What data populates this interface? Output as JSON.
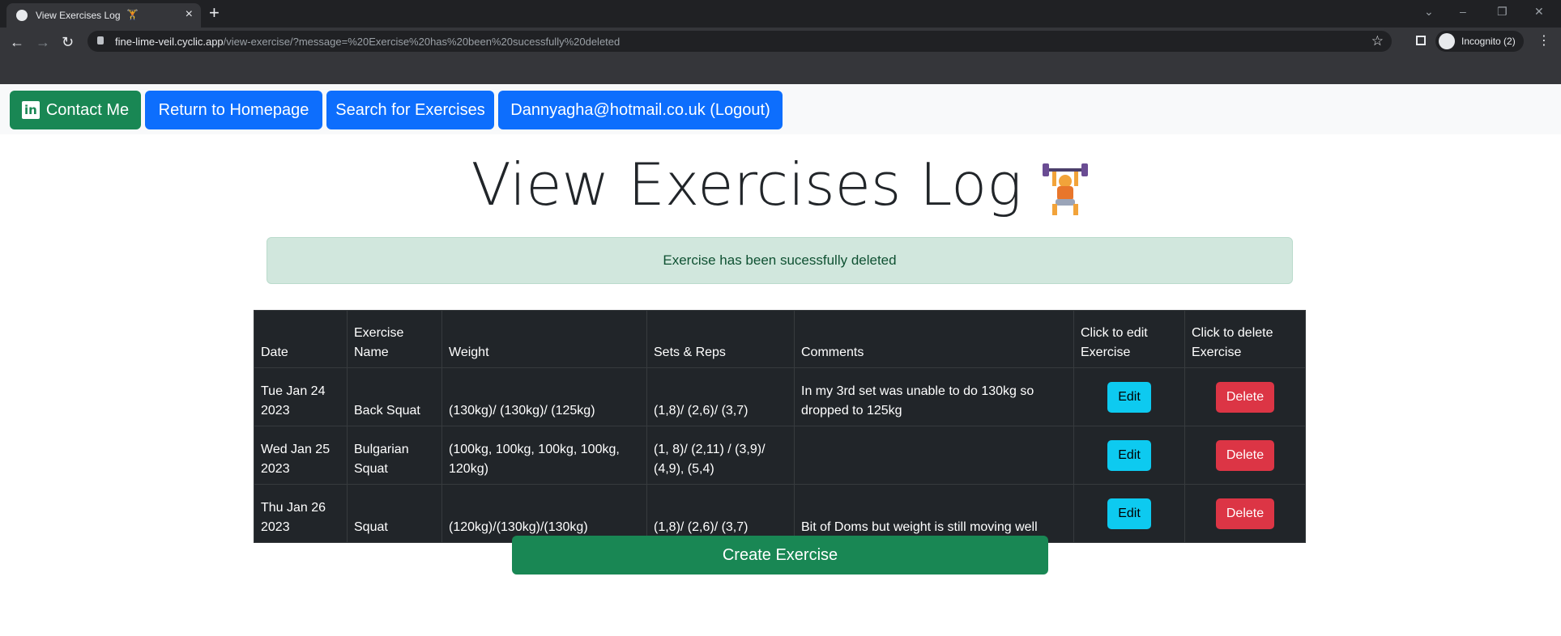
{
  "browser": {
    "tab_title": "View Exercises Log",
    "tab_emoji": "🏋",
    "tab_close": "×",
    "new_tab": "+",
    "url_host": "fine-lime-veil.cyclic.app",
    "url_path": "/view-exercise/?message=%20Exercise%20has%20been%20sucessfully%20deleted",
    "incognito_label": "Incognito (2)"
  },
  "nav": {
    "contact_label": "Contact Me",
    "home_label": "Return to Homepage",
    "search_label": "Search for Exercises",
    "logout_label": "Dannyagha@hotmail.co.uk (Logout)"
  },
  "page": {
    "title": "View Exercises Log",
    "alert": "Exercise has been sucessfully deleted",
    "create_label": "Create Exercise"
  },
  "table": {
    "headers": [
      "Date",
      "Exercise Name",
      "Weight",
      "Sets & Reps",
      "Comments",
      "Click to edit Exercise",
      "Click to delete Exercise"
    ],
    "edit_label": "Edit",
    "delete_label": "Delete",
    "rows": [
      {
        "date": "Tue Jan 24 2023",
        "name": "Back Squat",
        "weight": "(130kg)/ (130kg)/ (125kg)",
        "sets": "(1,8)/ (2,6)/ (3,7)",
        "comments": "In my 3rd set was unable to do 130kg so dropped to 125kg"
      },
      {
        "date": "Wed Jan 25 2023",
        "name": "Bulgarian Squat",
        "weight": "(100kg, 100kg, 100kg, 100kg, 120kg)",
        "sets": "(1, 8)/ (2,11) / (3,9)/ (4,9), (5,4)",
        "comments": ""
      },
      {
        "date": "Thu Jan 26 2023",
        "name": "Squat",
        "weight": "(120kg)/(130kg)/(130kg)",
        "sets": "(1,8)/ (2,6)/ (3,7)",
        "comments": "Bit of Doms but weight is still moving well"
      }
    ]
  },
  "colors": {
    "primary": "#0d6efd",
    "success": "#198754",
    "info": "#0dcaf0",
    "danger": "#dc3545",
    "table_dark": "#212529"
  }
}
